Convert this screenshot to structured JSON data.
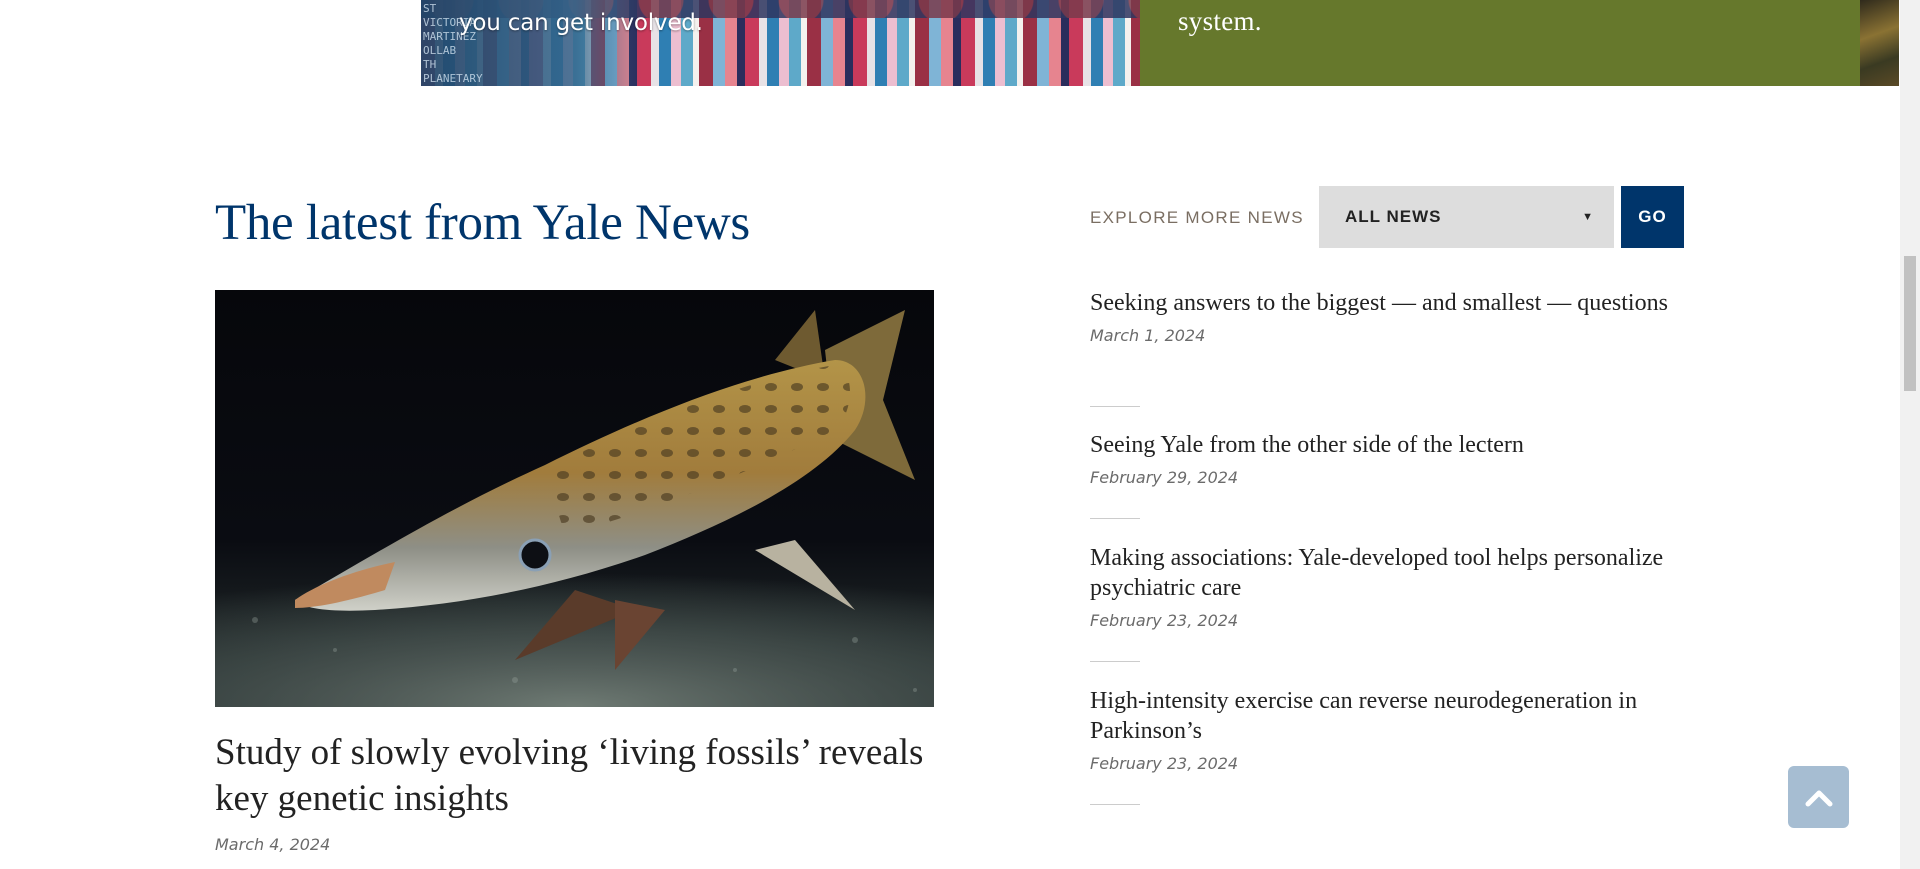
{
  "banner": {
    "handwriting": "ST VICTORIA MARTINEZ\nOLLAB\nTH PLANETARY SOLUTIONS",
    "left_caption": "you can get involved.",
    "right_caption": "system."
  },
  "section": {
    "title": "The latest from Yale News"
  },
  "explore": {
    "label": "EXPLORE MORE NEWS",
    "select_value": "ALL NEWS",
    "go_label": "GO"
  },
  "featured": {
    "headline": "Study of slowly evolving ‘living fossils’ reveals key genetic insights",
    "date": "March 4, 2024",
    "image_icon": "fish-photo"
  },
  "news_list": [
    {
      "title": "Seeking answers to the biggest — and smallest — questions",
      "date": "March 1, 2024"
    },
    {
      "title": "Seeing Yale from the other side of the lectern",
      "date": "February 29, 2024"
    },
    {
      "title": "Making associations: Yale-developed tool helps personalize psychiatric care",
      "date": "February 23, 2024"
    },
    {
      "title": "High-intensity exercise can reverse neurodegeneration in Parkinson’s",
      "date": "February 23, 2024"
    }
  ],
  "back_to_top": {
    "icon": "chevron-up-icon"
  },
  "colors": {
    "yale_blue": "#00356b",
    "banner_green": "#66782c",
    "back_to_top": "#a6bdd2",
    "select_bg": "#dddddd",
    "explore_label": "#7a6e62",
    "date_text": "#6b6b6b"
  }
}
